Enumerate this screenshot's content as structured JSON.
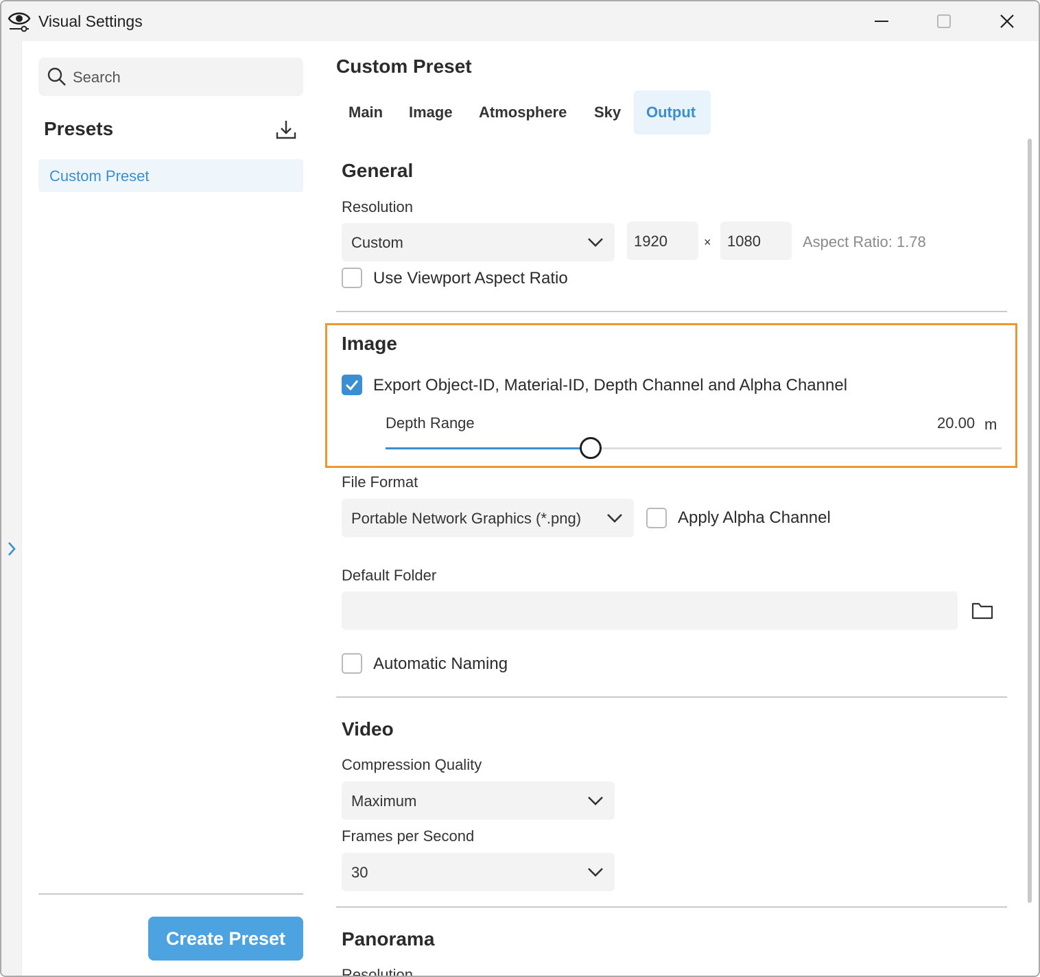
{
  "window": {
    "title": "Visual Settings"
  },
  "sidebar": {
    "search_placeholder": "Search",
    "presets_title": "Presets",
    "presets": [
      {
        "label": "Custom Preset",
        "selected": true
      }
    ],
    "create_button": "Create Preset"
  },
  "main": {
    "title": "Custom Preset",
    "tabs": [
      {
        "label": "Main",
        "active": false
      },
      {
        "label": "Image",
        "active": false
      },
      {
        "label": "Atmosphere",
        "active": false
      },
      {
        "label": "Sky",
        "active": false
      },
      {
        "label": "Output",
        "active": true
      }
    ],
    "general": {
      "title": "General",
      "resolution_label": "Resolution",
      "resolution_select": "Custom",
      "width": "1920",
      "times": "×",
      "height": "1080",
      "aspect_ratio": "Aspect Ratio: 1.78",
      "viewport_checkbox": {
        "label": "Use Viewport Aspect Ratio",
        "checked": false
      }
    },
    "image": {
      "title": "Image",
      "export_checkbox": {
        "label": "Export Object-ID, Material-ID, Depth Channel and Alpha Channel",
        "checked": true
      },
      "depth_range_label": "Depth Range",
      "depth_range_value": "20.00",
      "depth_range_unit": "m",
      "depth_range_fraction": 0.333,
      "file_format_label": "File Format",
      "file_format_select": "Portable Network Graphics (*.png)",
      "alpha_checkbox": {
        "label": "Apply Alpha Channel",
        "checked": false
      },
      "default_folder_label": "Default Folder",
      "default_folder_value": "",
      "auto_naming_checkbox": {
        "label": "Automatic Naming",
        "checked": false
      }
    },
    "video": {
      "title": "Video",
      "compression_label": "Compression Quality",
      "compression_select": "Maximum",
      "fps_label": "Frames per Second",
      "fps_select": "30"
    },
    "panorama": {
      "title": "Panorama",
      "resolution_label": "Resolution"
    }
  },
  "colors": {
    "accent": "#3a8fd0",
    "button": "#4ca3e0",
    "highlight_border": "#f0962e"
  },
  "icons": [
    "app-eye-icon",
    "minimize-icon",
    "maximize-icon",
    "close-icon",
    "search-icon",
    "import-icon",
    "chevron-down-icon",
    "checkmark-icon",
    "folder-icon",
    "chevron-right-icon"
  ]
}
